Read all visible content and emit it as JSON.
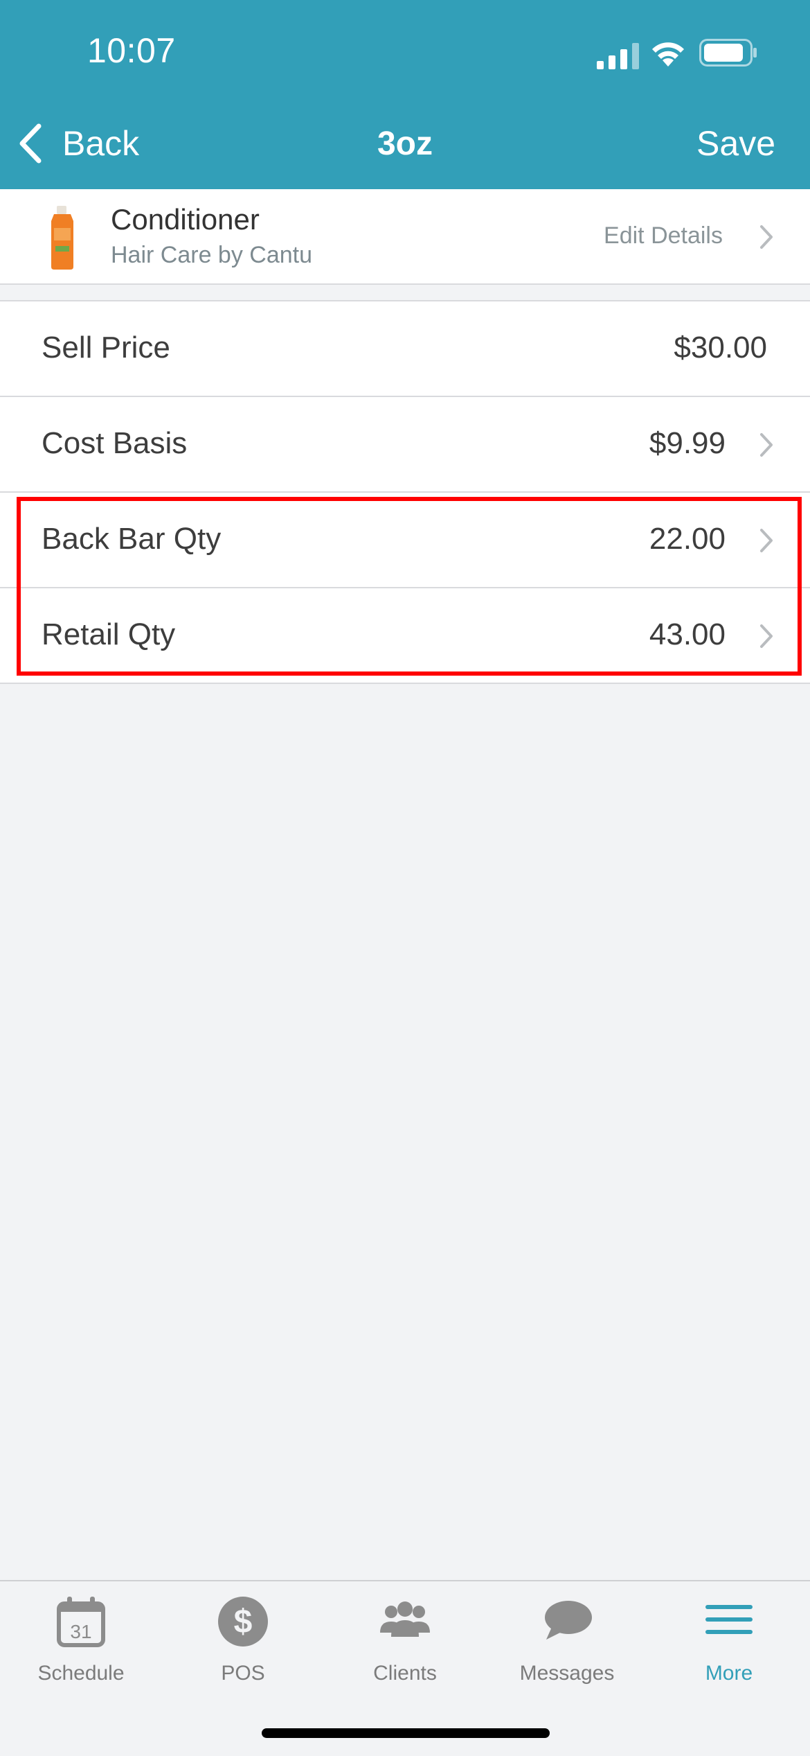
{
  "status_bar": {
    "time": "10:07"
  },
  "nav": {
    "back_label": "Back",
    "title": "3oz",
    "save_label": "Save"
  },
  "product": {
    "name": "Conditioner",
    "brand": "Hair Care by Cantu",
    "edit_label": "Edit Details"
  },
  "fields": [
    {
      "label": "Sell Price",
      "value": "$30.00"
    },
    {
      "label": "Cost Basis",
      "value": "$9.99"
    },
    {
      "label": "Back Bar Qty",
      "value": "22.00"
    },
    {
      "label": "Retail Qty",
      "value": "43.00"
    }
  ],
  "tabs": [
    {
      "label": "Schedule",
      "icon": "calendar-icon",
      "calendar_day": "31"
    },
    {
      "label": "POS",
      "icon": "dollar-icon"
    },
    {
      "label": "Clients",
      "icon": "clients-icon"
    },
    {
      "label": "Messages",
      "icon": "chat-bubble-icon"
    },
    {
      "label": "More",
      "icon": "menu-icon",
      "active": true
    }
  ],
  "colors": {
    "accent": "#329fb8",
    "highlight": "#ff0000",
    "tab_inactive": "#7b7b7b"
  }
}
